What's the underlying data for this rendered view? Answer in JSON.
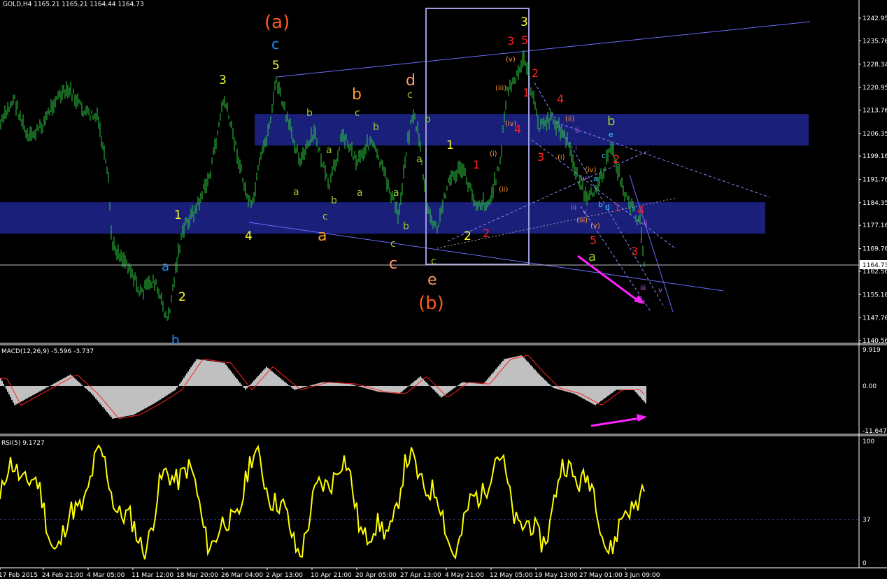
{
  "header": {
    "symbol_line": "GOLD,H4  1165.21 1165.21 1164.44 1164.73"
  },
  "chart_data": [
    {
      "type": "bar",
      "title": "GOLD,H4  1165.21 1165.21 1164.44 1164.73",
      "price_axis_labels": [
        "1242.95",
        "1235.76",
        "1228.34",
        "1220.95",
        "1213.76",
        "1206.35",
        "1199.16",
        "1191.76",
        "1184.35",
        "1177.16",
        "1169.76",
        "1164.73",
        "1162.56",
        "1155.16",
        "1147.76",
        "1140.56"
      ],
      "current_price": "1164.73",
      "ylim": [
        1140.56,
        1242.95
      ],
      "time_labels": [
        "17 Feb 2015",
        "24 Feb 21:00",
        "4 Mar 05:00",
        "11 Mar 12:00",
        "18 Mar 20:00",
        "26 Mar 04:00",
        "2 Apr 13:00",
        "10 Apr 21:00",
        "20 Apr 05:00",
        "27 Apr 13:00",
        "4 May 21:00",
        "12 May 05:00",
        "19 May 13:00",
        "27 May 01:00",
        "3 Jun 09:00"
      ],
      "zones": [
        {
          "from": 1202.5,
          "to": 1212.5
        },
        {
          "from": 1174.5,
          "to": 1184.5
        }
      ],
      "wave_labels": {
        "major": [
          "(a)",
          "(b)"
        ],
        "intermediate": [
          "a",
          "b",
          "c",
          "d",
          "e"
        ],
        "impulse_yellow": [
          "1",
          "2",
          "3",
          "4",
          "5"
        ],
        "impulse_red": [
          "1",
          "2",
          "3",
          "4",
          "5"
        ],
        "minor_green": [
          "a",
          "b",
          "c"
        ],
        "roman": [
          "(i)",
          "(ii)",
          "(iii)",
          "(iv)",
          "(v)"
        ],
        "small_roman": [
          "i",
          "ii",
          "iii",
          "iv",
          "v"
        ]
      }
    },
    {
      "type": "bar",
      "title": "MACD(12,26,9) -5.596 -3.737",
      "axis_labels": [
        "9.919",
        "0.00",
        "-11.647"
      ],
      "ylim": [
        -11.647,
        9.919
      ]
    },
    {
      "type": "line",
      "title": "RSI(5) 9.1727",
      "axis_labels": [
        "100",
        "37",
        "0"
      ],
      "ylim": [
        0,
        100
      ],
      "level": 37
    }
  ],
  "colors": {
    "candles": "#2ecc40",
    "zone": "#1a1f7a",
    "macd_hist": "#c0c0c0",
    "macd_signal": "#ff2020",
    "rsi": "#ffff00",
    "arrow": "#ff22ff",
    "trendline": "#6a6aff"
  }
}
